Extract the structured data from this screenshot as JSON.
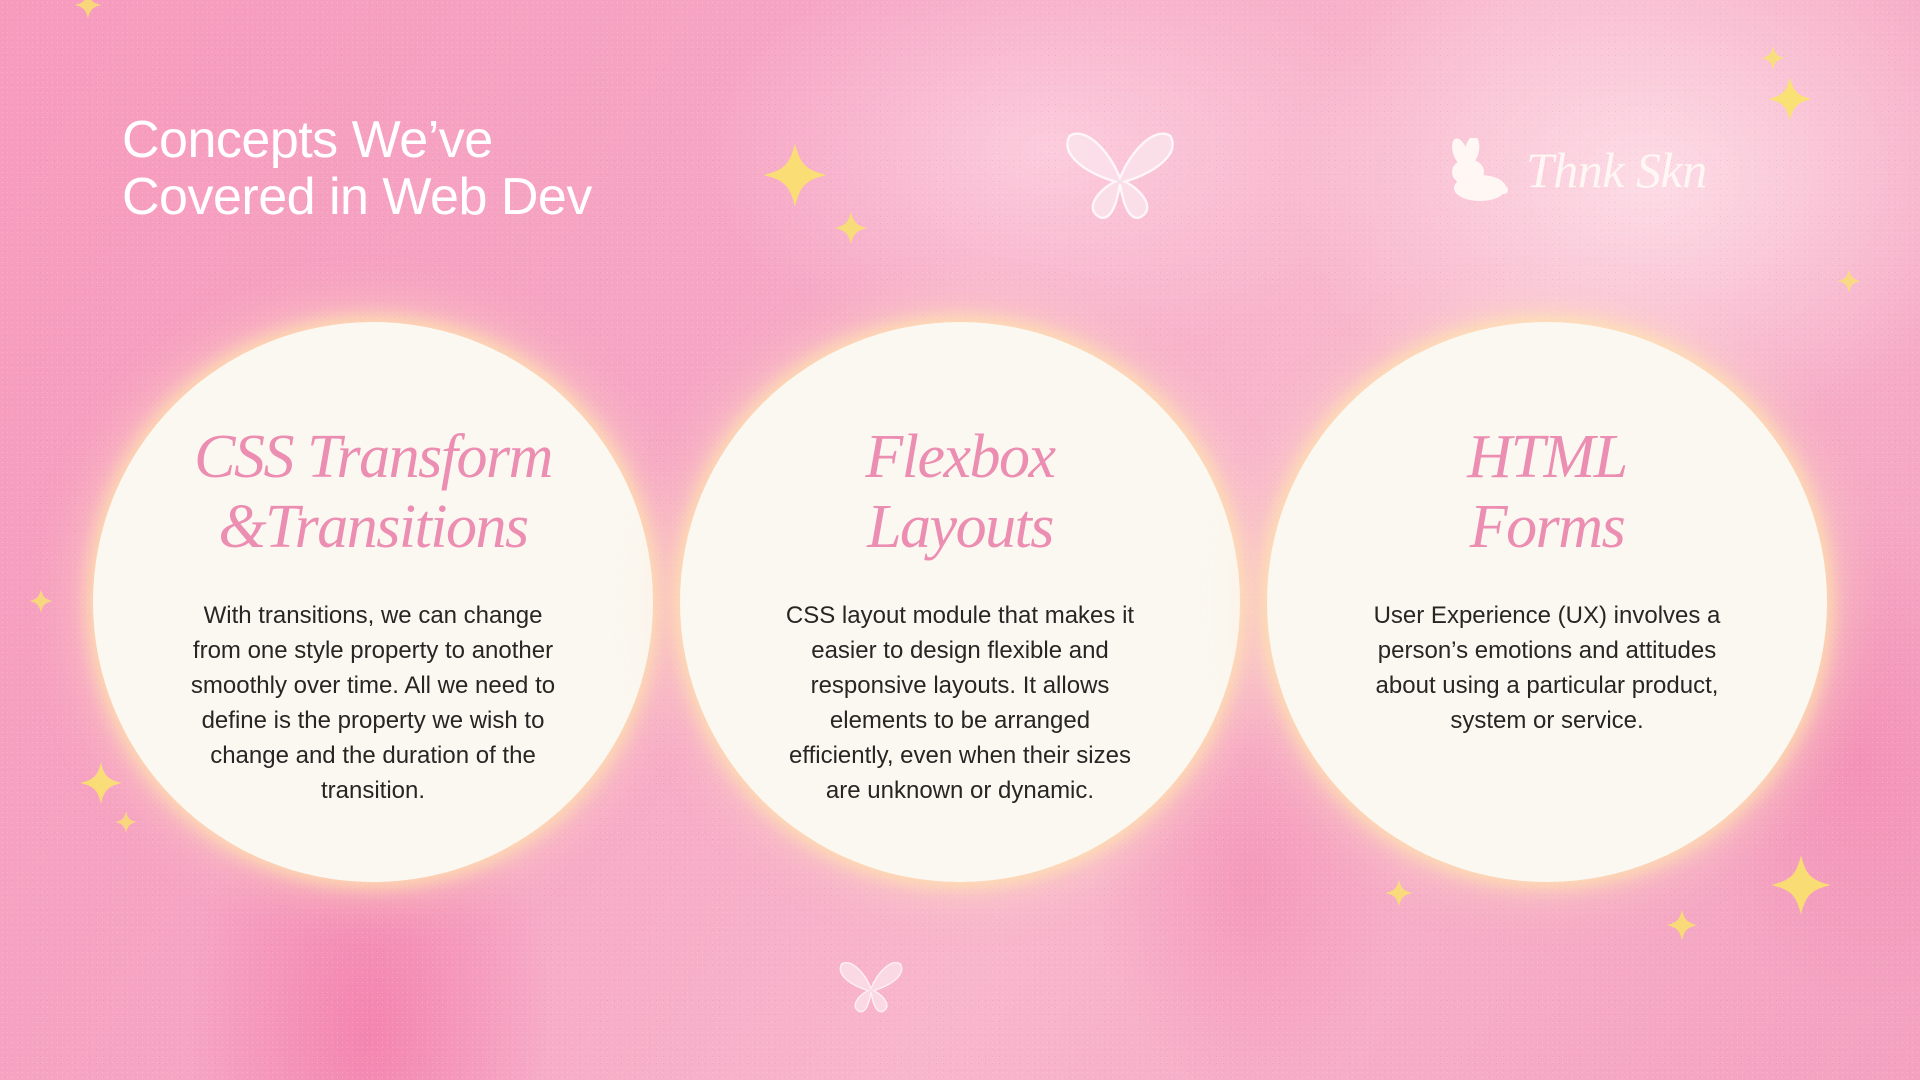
{
  "slide": {
    "title_line1": "Concepts We’ve",
    "title_line2": "Covered in Web Dev"
  },
  "brand": {
    "name": "Thnk Skn",
    "icon": "bunny-icon"
  },
  "cards": [
    {
      "title_line1": "CSS Transform",
      "title_line2": "&Transitions",
      "body": "With transitions, we can change from one style property to another smoothly over time. All we need to define is the property we wish to change and the duration of the transition."
    },
    {
      "title_line1": "Flexbox",
      "title_line2": "Layouts",
      "body": "CSS layout module that makes it easier to design flexible and responsive layouts. It allows elements to be arranged efficiently, even when their sizes are unknown or dynamic."
    },
    {
      "title_line1": "HTML",
      "title_line2": "Forms",
      "body": "User Experience (UX) involves a person’s emotions and attitudes about using a particular product, system or service."
    }
  ],
  "decorations": [
    "butterfly-icon",
    "sparkle-icon"
  ],
  "colors": {
    "background": "#f6a6c4",
    "circle": "#fbf8f1",
    "card_title": "#ec8db2",
    "body_text": "#2a2424",
    "sparkle": "#f9e36b"
  }
}
